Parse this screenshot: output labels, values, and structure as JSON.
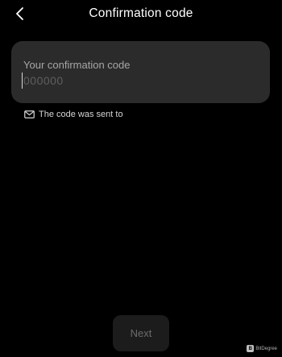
{
  "header": {
    "title": "Confirmation code",
    "back_icon": "chevron-left-icon"
  },
  "code_field": {
    "label": "Your confirmation code",
    "value": "",
    "placeholder": "000000"
  },
  "sent_notice": {
    "icon": "envelope-icon",
    "text": "The code was sent to"
  },
  "next_button": {
    "label": "Next",
    "disabled": true
  },
  "watermark": {
    "text": "BitDegree",
    "logo_letter": "B"
  },
  "colors": {
    "background": "#000000",
    "card": "#2b2b2b",
    "label": "#a6a6a6",
    "placeholder": "#5e5e5e",
    "button": "#1c1c1c",
    "button_text": "#6b6b6b"
  }
}
